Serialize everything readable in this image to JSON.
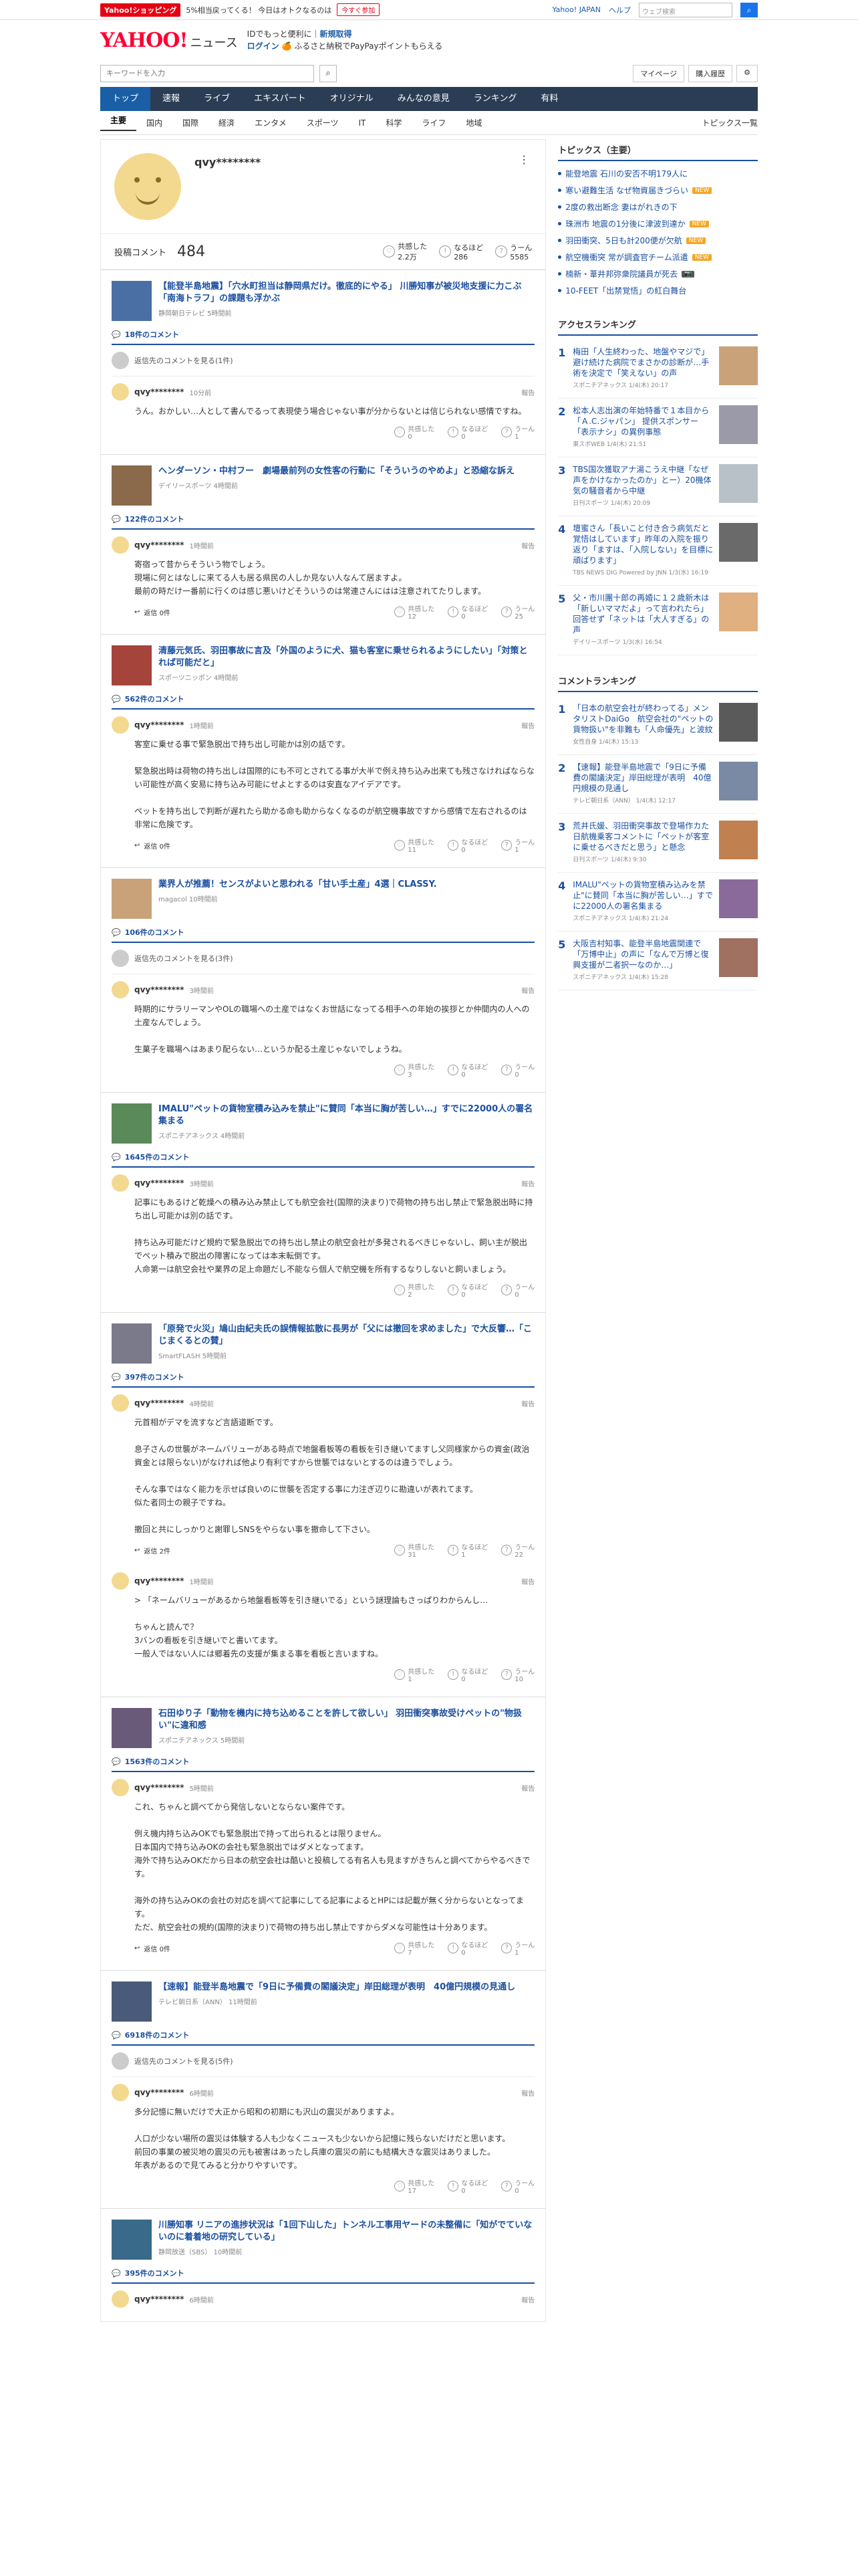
{
  "promo": {
    "shop": "Yahoo!ショッピング",
    "text": "5%相当戻ってくる！ 今日はオトクなるのは",
    "btn": "今すぐ参加",
    "links": [
      "Yahoo! JAPAN",
      "ヘルプ"
    ],
    "search_placeholder": "ウェブ検索"
  },
  "header": {
    "logo": "YAHOO!",
    "logo_sub": "ニュース",
    "promo_line1": "IDでもっと便利に",
    "promo_line1b": "新規取得",
    "promo_line2a": "ログイン",
    "promo_line2b": "ふるさと納税でPayPayポイントもらえる"
  },
  "searchrow": {
    "placeholder": "キーワードを入力",
    "buttons": [
      "マイページ",
      "購入履歴"
    ]
  },
  "nav": [
    "トップ",
    "速報",
    "ライブ",
    "エキスパート",
    "オリジナル",
    "みんなの意見",
    "ランキング",
    "有料"
  ],
  "subnav": [
    "主要",
    "国内",
    "国際",
    "経済",
    "エンタメ",
    "スポーツ",
    "IT",
    "科学",
    "ライフ",
    "地域"
  ],
  "subnav_all": "トピックス一覧",
  "profile": {
    "name": "qvy********",
    "label": "投稿コメント",
    "count": "484",
    "kyokan_label": "共感した",
    "kyokan": "2.2万",
    "naruhodo_label": "なるほど",
    "naruhodo": "286",
    "uun_label": "うーん",
    "uun": "5585"
  },
  "articles": [
    {
      "title": "【能登半島地震】「穴水町担当は静岡県だけ。徹底的にやる」 川勝知事が被災地支援に力こぶ 「南海トラフ」の課題も浮かぶ",
      "src": "静岡朝日テレビ 5時間前",
      "ccount": "18件のコメント",
      "more": "返信先のコメントを見る(1件)",
      "comments": [
        {
          "user": "qvy********",
          "time": "10分前",
          "body": "うん。おかしい…人として書んでるって表現使う場合じゃない事が分からないとは信じられない感情ですね。",
          "kyokan": "0",
          "naruhodo": "0",
          "uun": "1",
          "reply": ""
        }
      ]
    },
    {
      "title": "ヘンダーソン・中村フー　劇場最前列の女性客の行動に「そういうのやめよ」と恐縮な訴え",
      "src": "デイリースポーツ 4時間前",
      "ccount": "122件のコメント",
      "more": "",
      "comments": [
        {
          "user": "qvy********",
          "time": "1時間前",
          "body": "寄宿って昔からそういう物でしょう。\n現場に何とはなしに来てる人も居る県民の人しか見ない人なんて居ますよ。\n最前の時だけ一番前に行くのは感じ悪いけどそういうのは常連さんにはは注意されてたりします。",
          "kyokan": "12",
          "naruhodo": "0",
          "uun": "25",
          "reply": "返信 0件"
        }
      ]
    },
    {
      "title": "清藤元気氏、羽田事故に言及「外国のように犬、猫も客室に乗せられるようにしたい」「対策とれば可能だと」",
      "src": "スポーツニッポン 4時間前",
      "ccount": "562件のコメント",
      "more": "",
      "comments": [
        {
          "user": "qvy********",
          "time": "1時間前",
          "body": "客室に乗せる事で緊急脱出で持ち出し可能かは別の話です。\n\n緊急脱出時は荷物の持ち出しは国際的にも不可とされてる事が大半で例え持ち込み出来ても残さなければならない可能性が高く安易に持ち込み可能にせよとするのは安直なアイデアです。\n\nペットを持ち出しで判断が遅れたら助かる命も助からなくなるのが航空機事故ですから感情で左右されるのは非常に危険です。",
          "kyokan": "11",
          "naruhodo": "0",
          "uun": "1",
          "reply": "返信 0件"
        }
      ]
    },
    {
      "title": "業界人が推薦！センスがよいと思われる「甘い手土産」4選｜CLASSY.",
      "src": "magacol 10時間前",
      "ccount": "106件のコメント",
      "more": "返信先のコメントを見る(3件)",
      "comments": [
        {
          "user": "qvy********",
          "time": "3時間前",
          "body": "時期的にサラリーマンやOLの職場への土産ではなくお世話になってる相手への年始の挨拶とか仲間内の人への土産なんでしょう。\n\n生菓子を職場へはあまり配らない…というか配る土産じゃないでしょうね。",
          "kyokan": "3",
          "naruhodo": "0",
          "uun": "0",
          "reply": ""
        }
      ]
    },
    {
      "title": "IMALU\"ペットの貨物室積み込みを禁止\"に賛同「本当に胸が苦しい…」すでに22000人の署名集まる",
      "src": "スポニチアネックス 4時間前",
      "ccount": "1645件のコメント",
      "more": "",
      "comments": [
        {
          "user": "qvy********",
          "time": "3時間前",
          "body": "記事にもあるけど乾燥への積み込み禁止しても航空会社(国際的決まり)で荷物の持ち出し禁止で緊急脱出時に持ち出し可能かは別の話です。\n\n持ち込み可能だけど規約で緊急脱出での持ち出し禁止の航空会社が多発されるべきじゃないし、飼い主が脱出でペット積みで脱出の障害になっては本末転倒です。\n人命第一は航空会社や業界の足上命題だし不能なら個人で航空機を所有するなりしないと飼いましょう。",
          "kyokan": "2",
          "naruhodo": "0",
          "uun": "0",
          "reply": ""
        }
      ]
    },
    {
      "title": "「原発で火災」鳩山由紀夫氏の誤情報拡散に長男が「父には撤回を求めました」で大反響…「こじまくるとの賛」",
      "src": "SmartFLASH 5時間前",
      "ccount": "397件のコメント",
      "more": "",
      "comments": [
        {
          "user": "qvy********",
          "time": "4時間前",
          "body": "元首相がデマを流すなど言語道断です。\n\n息子さんの世襲がネームバリューがある時点で地盤看板等の看板を引き継いてますし父同様家からの資金(政治資金とは限らない)がなければ他より有利ですから世襲ではないとするのは違うでしょう。\n\nそんな事ではなく能力を示せば良いのに世襲を否定する事に力注ぎ辺りに勘違いが表れてます。\n似た者同士の親子ですね。\n\n撤回と共にしっかりと謝罪しSNSをやらない事を撤命して下さい。",
          "kyokan": "31",
          "naruhodo": "1",
          "uun": "22",
          "reply": "返信 2件"
        },
        {
          "user": "qvy********",
          "time": "1時間前",
          "body": "> 「ネームバリューがあるから地盤看板等を引き継いでる」という謎理論もさっぱりわからんし…\n\nちゃんと読んで？\n3バンの看板を引き継いでと書いてます。\n一般人ではない人には郷着先の支援が集まる事を看板と言いますね。",
          "kyokan": "1",
          "naruhodo": "0",
          "uun": "10",
          "reply": ""
        }
      ]
    },
    {
      "title": "石田ゆり子「動物を機内に持ち込めることを許して欲しい」 羽田衝突事故受けペットの\"物扱い\"に違和感",
      "src": "スポニチアネックス 5時間前",
      "ccount": "1563件のコメント",
      "more": "",
      "comments": [
        {
          "user": "qvy********",
          "time": "5時間前",
          "body": "これ、ちゃんと調べてから発信しないとならない案件です。\n\n例え機内持ち込みOKでも緊急脱出で持って出られるとは限りません。\n日本国内で持ち込みOKの会社も緊急脱出ではダメとなってます。\n海外で持ち込みOKだから日本の航空会社は酷いと投稿してる有名人も見ますがきちんと調べてからやるべきです。\n\n海外の持ち込みOKの会社の対応を調べて記事にしてる記事によるとHPには記載が無く分からないとなってます。\nただ、航空会社の規約(国際的決まり)で荷物の持ち出し禁止ですからダメな可能性は十分あります。",
          "kyokan": "7",
          "naruhodo": "0",
          "uun": "1",
          "reply": "返信 0件"
        }
      ]
    },
    {
      "title": "【速報】能登半島地震で「9日に予備費の閣議決定」岸田総理が表明　40億円規模の見通し",
      "src": "テレビ朝日系（ANN） 11時間前",
      "ccount": "6918件のコメント",
      "more": "返信先のコメントを見る(5件)",
      "comments": [
        {
          "user": "qvy********",
          "time": "6時間前",
          "body": "多分記憶に無いだけで大正から昭和の初期にも沢山の震災がありますよ。\n\n人口が少ない場所の震災は体験する人も少なくニュースも少ないから記憶に残らないだけだと思います。\n前回の事業の被災地の震災の元も被害はあったし兵庫の震災の前にも結構大きな震災はありました。\n年表があるので見てみると分かりやすいです。",
          "kyokan": "17",
          "naruhodo": "0",
          "uun": "0",
          "reply": ""
        }
      ]
    },
    {
      "title": "川勝知事 リニアの進捗状況は「1回下山した」トンネル工事用ヤードの未整備に「知がでていないのに着着地の研究している」",
      "src": "静岡放送（SBS） 10時間前",
      "ccount": "395件のコメント",
      "more": "",
      "comments": [
        {
          "user": "qvy********",
          "time": "6時間前",
          "body": "",
          "kyokan": "",
          "naruhodo": "",
          "uun": "",
          "reply": ""
        }
      ]
    }
  ],
  "sidebar": {
    "topics_title": "トピックス（主要）",
    "topics": [
      {
        "t": "能登地震 石川の安否不明179人に",
        "b": ""
      },
      {
        "t": "寒い避難生活 なぜ物資届きづらい",
        "b": "NEW"
      },
      {
        "t": "2度の救出断念 妻はがれきの下",
        "b": ""
      },
      {
        "t": "珠洲市 地震の1分後に津波到達か",
        "b": "NEW"
      },
      {
        "t": "羽田衝突、5日も計200便が欠航",
        "b": "NEW"
      },
      {
        "t": "航空機衝突 常が調査官チーム派遣",
        "b": "NEW"
      },
      {
        "t": "楠新・葦井邦弥衆院議員が死去",
        "b": "cam"
      },
      {
        "t": "10-FEET「出禁覚悟」の紅白舞台",
        "b": ""
      }
    ],
    "access_title": "アクセスランキング",
    "access": [
      {
        "t": "梅田「人生終わった、地盤やマジで」避け続けた病院でまさかの診断が…手術を決定で「笑えない」の声",
        "s": "スポニチアネックス 1/4(木) 20:17"
      },
      {
        "t": "松本人志出演の年始特番で１本目から「Ａ.C.ジャパン」 提供スポンサー「表示ナシ」の異例事態",
        "s": "東スポWEB 1/4(木) 21:51"
      },
      {
        "t": "TBS国次獲取アナ湯こうえ中継「なぜ声をかけなかったのか」とー）20機体気の騒音者から中継",
        "s": "日刊スポーツ 1/4(木) 20:09"
      },
      {
        "t": "壇蜜さん「長いこと付き合う病気だと覚悟はしています」昨年の入院を振り返り「ますは、「入院しない」を目標に頑ばります」",
        "s": "TBS NEWS DIG Powered by JNN 1/3(水) 16:19"
      },
      {
        "t": "父・市川團十郎の再婚に１２歳新木は「新しいママだよ」って言われたら」回答せず「ネットは「大人すぎる」の声",
        "s": "デイリースポーツ 1/3(水) 16:54"
      }
    ],
    "comment_title": "コメントランキング",
    "comment_rank": [
      {
        "t": "「日本の航空会社が終わってる」メンタリストDaiGo　航空会社の\"ペットの貨物扱い\"を非難も「人命優先」と波紋",
        "s": "女性自身 1/4(木) 15:13"
      },
      {
        "t": "【速報】能登半島地震で「9日に予備費の閣議決定」岸田総理が表明　40億円規模の見通し",
        "s": "テレビ朝日系（ANN） 1/4(木) 12:17"
      },
      {
        "t": "荒井氏媛、羽田衝突事故で登場作カた日航機乗客コメントに「ペットが客室に乗せるべきだと思う」と懸念",
        "s": "日刊スポーツ 1/4(木) 9:30"
      },
      {
        "t": "IMALU\"ペットの貨物室積み込みを禁止\"に賛同「本当に胸が苦しい…」すでに22000人の署名集まる",
        "s": "スポニチアネックス 1/4(木) 21:24"
      },
      {
        "t": "大阪吉村知事、能登半島地震関連で「万博中止」の声に「なんで万博と復興支援が二者択一なのか…」",
        "s": "スポニチアネックス 1/4(木) 15:28"
      }
    ]
  },
  "icons": {
    "search": "search-icon",
    "gear": "gear-icon",
    "menu": "kebab-menu-icon",
    "comment": "comment-icon",
    "reply": "reply-icon"
  }
}
